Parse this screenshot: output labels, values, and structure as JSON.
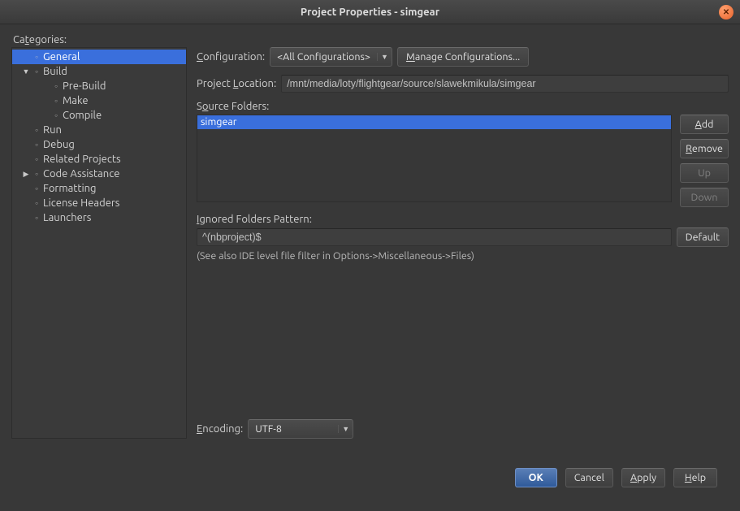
{
  "window": {
    "title": "Project Properties - simgear"
  },
  "categories_label": {
    "pre": "Ca",
    "u": "t",
    "post": "egories:"
  },
  "tree": [
    {
      "indent": 0,
      "arrow": "",
      "bullet": "○",
      "label": "General",
      "selected": true
    },
    {
      "indent": 0,
      "arrow": "▼",
      "bullet": "○",
      "label": "Build"
    },
    {
      "indent": 1,
      "arrow": "",
      "bullet": "○",
      "label": "Pre-Build"
    },
    {
      "indent": 1,
      "arrow": "",
      "bullet": "○",
      "label": "Make"
    },
    {
      "indent": 1,
      "arrow": "",
      "bullet": "○",
      "label": "Compile"
    },
    {
      "indent": 0,
      "arrow": "",
      "bullet": "○",
      "label": "Run"
    },
    {
      "indent": 0,
      "arrow": "",
      "bullet": "○",
      "label": "Debug"
    },
    {
      "indent": 0,
      "arrow": "",
      "bullet": "○",
      "label": "Related Projects"
    },
    {
      "indent": 0,
      "arrow": "▶",
      "bullet": "○",
      "label": "Code Assistance"
    },
    {
      "indent": 0,
      "arrow": "",
      "bullet": "○",
      "label": "Formatting"
    },
    {
      "indent": 0,
      "arrow": "",
      "bullet": "○",
      "label": "License Headers"
    },
    {
      "indent": 0,
      "arrow": "",
      "bullet": "○",
      "label": "Launchers"
    }
  ],
  "form": {
    "configuration_label": {
      "u": "C",
      "post": "onfiguration:"
    },
    "configuration_value": "<All Configurations>",
    "manage_btn": {
      "u": "M",
      "post": "anage Configurations..."
    },
    "project_location_label": {
      "pre": "Project ",
      "u": "L",
      "post": "ocation:"
    },
    "project_location_value": "/mnt/media/loty/flightgear/source/slawekmikula/simgear",
    "source_folders_label": {
      "pre": "S",
      "u": "o",
      "post": "urce Folders:"
    },
    "source_folders": [
      "simgear"
    ],
    "add_btn": {
      "u": "A",
      "post": "dd"
    },
    "remove_btn": {
      "u": "R",
      "post": "emove"
    },
    "up_btn": "Up",
    "down_btn": "Down",
    "ignored_label": {
      "u": "I",
      "post": "gnored Folders Pattern:"
    },
    "ignored_value": "^(nbproject)$",
    "default_btn": "Default",
    "note": "(See also IDE level file filter in Options->Miscellaneous->Files)",
    "encoding_label": {
      "u": "E",
      "post": "ncoding:"
    },
    "encoding_value": "UTF-8"
  },
  "footer": {
    "ok": "OK",
    "cancel": "Cancel",
    "apply": {
      "u": "A",
      "post": "pply"
    },
    "help": {
      "u": "H",
      "post": "elp"
    }
  }
}
